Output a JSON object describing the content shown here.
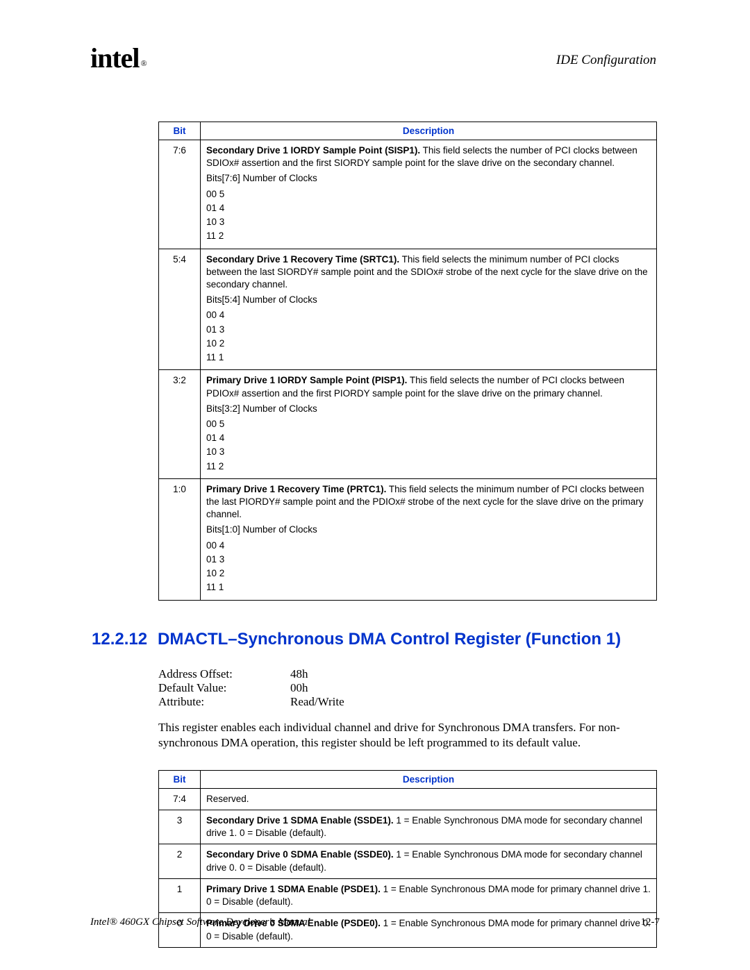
{
  "header": {
    "logo": "intel",
    "logo_sub": "®",
    "chapter": "IDE Configuration"
  },
  "table1": {
    "headers": {
      "bit": "Bit",
      "desc": "Description"
    },
    "rows": [
      {
        "bit": "7:6",
        "title": "Secondary Drive 1 IORDY Sample Point (SISP1).",
        "body": " This field selects the number of PCI clocks between SDIOx# assertion and the first SIORDY sample point for the slave drive on the secondary channel.",
        "bitslabel": "Bits[7:6] Number of Clocks",
        "map": [
          "00 5",
          "01 4",
          "10 3",
          "11 2"
        ]
      },
      {
        "bit": "5:4",
        "title": "Secondary Drive 1 Recovery Time (SRTC1).",
        "body": " This field selects the minimum number of PCI clocks between the last SIORDY# sample point and the SDIOx# strobe of the next cycle for the slave drive on the secondary channel.",
        "bitslabel": "Bits[5:4] Number of Clocks",
        "map": [
          "00 4",
          "01 3",
          "10 2",
          "11 1"
        ]
      },
      {
        "bit": "3:2",
        "title": "Primary Drive 1 IORDY Sample Point (PISP1).",
        "body": " This field selects the number of PCI clocks between PDIOx# assertion and the first PIORDY sample point for the slave drive on the primary channel.",
        "bitslabel": "Bits[3:2] Number of Clocks",
        "map": [
          "00 5",
          "01 4",
          "10 3",
          "11 2"
        ]
      },
      {
        "bit": "1:0",
        "title": "Primary Drive 1 Recovery Time (PRTC1).",
        "body": " This field selects the minimum number of PCI clocks between the last PIORDY# sample point and the PDIOx# strobe of the next cycle for the slave drive on the primary channel.",
        "bitslabel": "Bits[1:0] Number of Clocks",
        "map": [
          "00 4",
          "01 3",
          "10 2",
          "11 1"
        ]
      }
    ]
  },
  "section": {
    "number": "12.2.12",
    "title": "DMACTL–Synchronous DMA Control Register (Function 1)"
  },
  "reginfo": {
    "labels": {
      "addr": "Address Offset:",
      "def": "Default Value:",
      "attr": "Attribute:"
    },
    "values": {
      "addr": "48h",
      "def": "00h",
      "attr": "Read/Write"
    }
  },
  "regdesc": "This register enables each individual channel and drive for Synchronous DMA transfers. For non-synchronous DMA operation, this register should be left programmed to its default value.",
  "table2": {
    "headers": {
      "bit": "Bit",
      "desc": "Description"
    },
    "rows": [
      {
        "bit": "7:4",
        "title": "",
        "body": "Reserved."
      },
      {
        "bit": "3",
        "title": "Secondary Drive 1 SDMA Enable (SSDE1).",
        "body": " 1 = Enable Synchronous DMA mode for secondary channel drive 1. 0 = Disable (default)."
      },
      {
        "bit": "2",
        "title": "Secondary Drive 0 SDMA Enable (SSDE0).",
        "body": " 1 = Enable Synchronous DMA mode for secondary channel drive 0. 0 = Disable (default)."
      },
      {
        "bit": "1",
        "title": "Primary Drive 1 SDMA Enable (PSDE1).",
        "body": " 1 = Enable Synchronous DMA mode for primary channel drive 1. 0 = Disable (default)."
      },
      {
        "bit": "0",
        "title": "Primary Drive 0 SDMA Enable (PSDE0).",
        "body": " 1 = Enable Synchronous DMA mode for primary channel drive 0. 0 = Disable (default)."
      }
    ]
  },
  "footer": {
    "left": "Intel® 460GX Chipset Software Developer's Manual",
    "right": "12-7"
  }
}
